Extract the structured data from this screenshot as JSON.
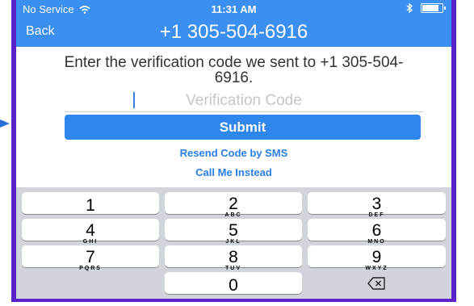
{
  "status_bar": {
    "carrier": "No Service",
    "time": "11:31 AM",
    "battery_level": 0.9
  },
  "nav": {
    "back_label": "Back",
    "title": "+1 305-504-6916"
  },
  "prompt": {
    "instructions": "Enter the verification code we sent to +1 305-504-6916.",
    "code_placeholder": "Verification Code",
    "code_value": ""
  },
  "actions": {
    "submit_label": "Submit",
    "resend_label": "Resend Code by SMS",
    "call_label": "Call Me Instead"
  },
  "keypad": {
    "keys": [
      {
        "num": "1",
        "letters": ""
      },
      {
        "num": "2",
        "letters": "ABC"
      },
      {
        "num": "3",
        "letters": "DEF"
      },
      {
        "num": "4",
        "letters": "GHI"
      },
      {
        "num": "5",
        "letters": "JKL"
      },
      {
        "num": "6",
        "letters": "MNO"
      },
      {
        "num": "7",
        "letters": "PQRS"
      },
      {
        "num": "8",
        "letters": "TUV"
      },
      {
        "num": "9",
        "letters": "WXYZ"
      },
      {
        "num": "0",
        "letters": ""
      }
    ],
    "delete_icon": "backspace-icon"
  },
  "colors": {
    "accent": "#3b8ff0",
    "frame": "#5a22c9",
    "keyboard_bg": "#d1d5db"
  }
}
